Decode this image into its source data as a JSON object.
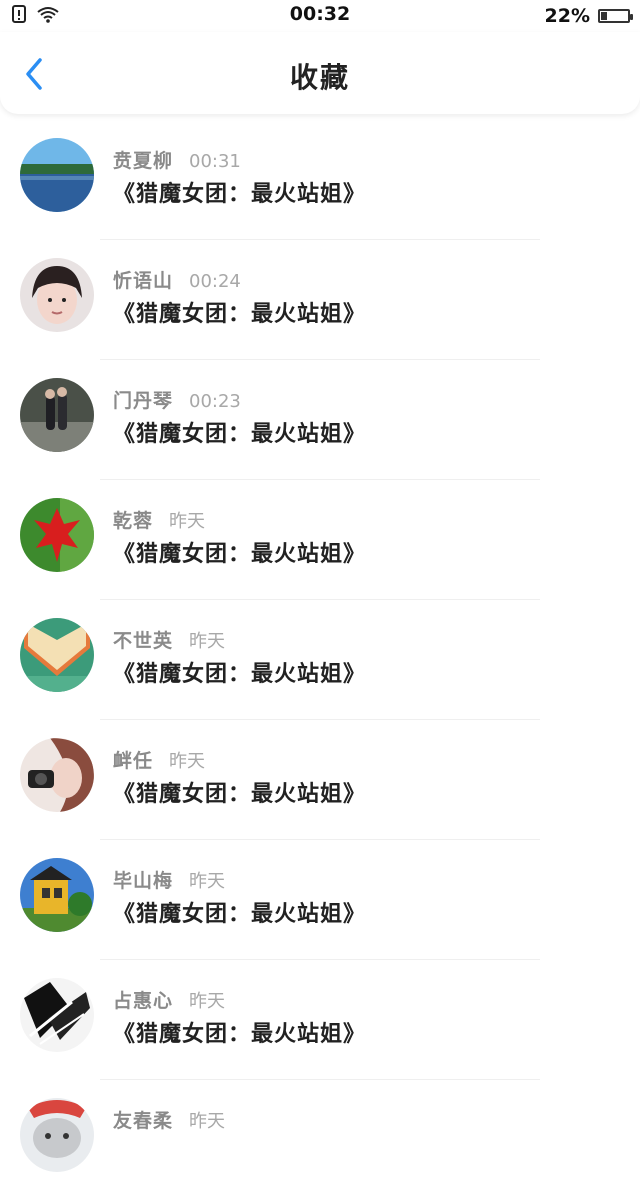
{
  "status_bar": {
    "time": "00:32",
    "battery_percent": "22%",
    "battery_level": 0.22,
    "icons": [
      "sim-alert-icon",
      "wifi-icon",
      "battery-icon"
    ]
  },
  "header": {
    "title": "收藏",
    "back_icon": "chevron-left-icon",
    "accent_color": "#2b8ef3"
  },
  "items": [
    {
      "name": "贲夏柳",
      "time": "00:31",
      "title": "《猎魔女团：最火站姐》"
    },
    {
      "name": "忻语山",
      "time": "00:24",
      "title": "《猎魔女团：最火站姐》"
    },
    {
      "name": "门丹琴",
      "time": "00:23",
      "title": "《猎魔女团：最火站姐》"
    },
    {
      "name": "乾蓉",
      "time": "昨天",
      "title": "《猎魔女团：最火站姐》"
    },
    {
      "name": "不世英",
      "time": "昨天",
      "title": "《猎魔女团：最火站姐》"
    },
    {
      "name": "衅任",
      "time": "昨天",
      "title": "《猎魔女团：最火站姐》"
    },
    {
      "name": "毕山梅",
      "time": "昨天",
      "title": "《猎魔女团：最火站姐》"
    },
    {
      "name": "占惠心",
      "time": "昨天",
      "title": "《猎魔女团：最火站姐》"
    },
    {
      "name": "友春柔",
      "time": "昨天",
      "title": ""
    }
  ]
}
